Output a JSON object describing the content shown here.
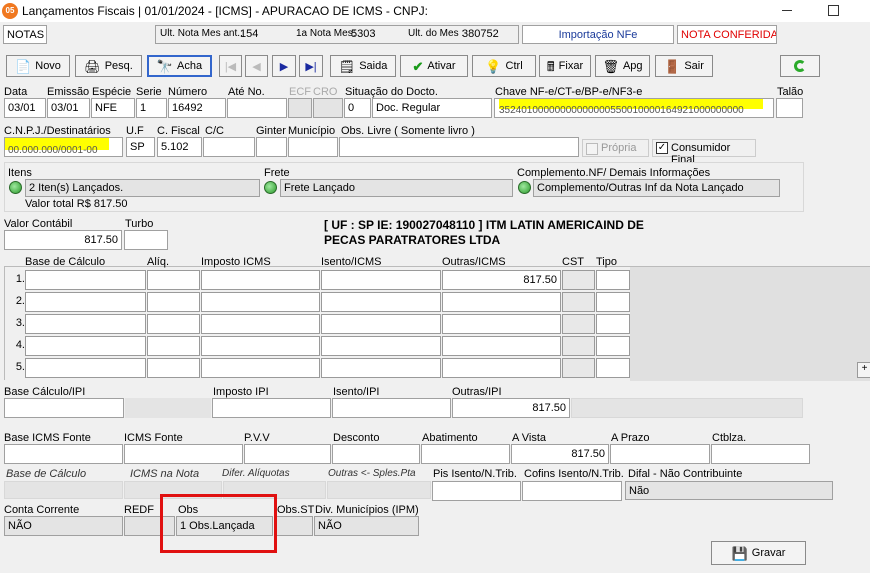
{
  "window": {
    "title": "Lançamentos Fiscais | 01/01/2024 - [ICMS] - APURACAO DE ICMS - CNPJ:",
    "app_badge": "05"
  },
  "infobar": {
    "notas": "NOTAS",
    "ult_nota_label": "Ult. Nota Mes ant.:",
    "ult_nota_value": "154",
    "primeira_nota_label": "1a Nota Mes:",
    "primeira_nota_value": "5303",
    "ult_mes_label": "Ult. do Mes :",
    "ult_mes_value": "380752",
    "importacao": "Importação NFe",
    "status": "NOTA CONFERIDA"
  },
  "toolbar": {
    "novo": "Novo",
    "pesq": "Pesq.",
    "acha": "Acha",
    "saida": "Saida",
    "ativar": "Ativar",
    "ctrl": "Ctrl",
    "fixar": "Fixar",
    "apg": "Apg",
    "sair": "Sair"
  },
  "header": {
    "labels": {
      "data": "Data",
      "emissao": "Emissão",
      "especie": "Espécie",
      "serie": "Serie",
      "numero": "Número",
      "ate_no": "Até No.",
      "ecf": "ECF",
      "cro": "CRO",
      "situacao": "Situação do Docto.",
      "chave": "Chave NF-e/CT-e/BP-e/NF3-e",
      "talao": "Talão"
    },
    "values": {
      "data": "03/01",
      "emissao": "03/01",
      "especie": "NFE",
      "serie": "1",
      "numero": "16492",
      "ate_no": "",
      "situacao_code": "0",
      "situacao_desc": "Doc. Regular",
      "chave": "35240100000000000000550010000164921000000000",
      "talao": ""
    }
  },
  "dest": {
    "labels": {
      "cnpj": "C.N.P.J./Destinatários",
      "uf": "U.F",
      "cfiscal": "C. Fiscal",
      "cc": "C/C",
      "ginter": "Ginter",
      "municipio": "Município",
      "obs_livre": "Obs. Livre ( Somente livro )"
    },
    "values": {
      "cnpj": "00.000.000/0001-00",
      "uf": "SP",
      "cfiscal": "5.102",
      "cc": "",
      "ginter": "",
      "municipio": "",
      "obs_livre": ""
    },
    "propria": "Própria",
    "propria_checked": false,
    "consumidor": "Consumidor Final",
    "consumidor_checked": true
  },
  "summary": {
    "itens_label": "Itens",
    "itens_value": "2 Iten(s) Lançados.",
    "valor_total": "Valor total R$ 817.50",
    "frete_label": "Frete",
    "frete_value": "Frete Lançado",
    "compl_label": "Complemento.NF/ Demais Informações",
    "compl_value": "Complemento/Outras Inf da Nota Lançado"
  },
  "valor": {
    "contabil_label": "Valor Contábil",
    "contabil_value": "817.50",
    "turbo_label": "Turbo",
    "turbo_value": "",
    "company_line1": "[ UF : SP IE: 190027048110 ] ITM LATIN AMERICAIND DE",
    "company_line2": "PECAS PARATRATORES LTDA"
  },
  "icms_table": {
    "headers": [
      "Base de Cálculo",
      "Alíq.",
      "Imposto ICMS",
      "Isento/ICMS",
      "Outras/ICMS",
      "CST",
      "Tipo"
    ],
    "rows": [
      {
        "n": "1.",
        "base": "",
        "aliq": "",
        "imposto": "",
        "isento": "",
        "outras": "817.50",
        "cst": "",
        "tipo": ""
      },
      {
        "n": "2.",
        "base": "",
        "aliq": "",
        "imposto": "",
        "isento": "",
        "outras": "",
        "cst": "",
        "tipo": ""
      },
      {
        "n": "3.",
        "base": "",
        "aliq": "",
        "imposto": "",
        "isento": "",
        "outras": "",
        "cst": "",
        "tipo": ""
      },
      {
        "n": "4.",
        "base": "",
        "aliq": "",
        "imposto": "",
        "isento": "",
        "outras": "",
        "cst": "",
        "tipo": ""
      },
      {
        "n": "5.",
        "base": "",
        "aliq": "",
        "imposto": "",
        "isento": "",
        "outras": "",
        "cst": "",
        "tipo": ""
      }
    ],
    "expand": "+"
  },
  "ipi": {
    "base_label": "Base Cálculo/IPI",
    "imposto_label": "Imposto IPI",
    "isento_label": "Isento/IPI",
    "outras_label": "Outras/IPI",
    "base": "",
    "imposto": "",
    "isento": "",
    "outras": "817.50"
  },
  "fonte": {
    "base_label": "Base ICMS Fonte",
    "icms_label": "ICMS Fonte",
    "pvv_label": "P.V.V",
    "desconto_label": "Desconto",
    "abatimento_label": "Abatimento",
    "vista_label": "A Vista",
    "prazo_label": "A Prazo",
    "ctblza_label": "Ctblza.",
    "vista": "817.50"
  },
  "difal": {
    "base_label": "Base de Cálculo",
    "icms_nota_label": "ICMS na Nota",
    "dif_aliq_label": "Difer. Alíquotas",
    "outras_label": "Outras <- Sples.Pta",
    "pis_label": "Pis Isento/N.Trib.",
    "cofins_label": "Cofins Isento/N.Trib.",
    "difal_label": "Difal - Não Contribuinte",
    "difal_value": "Não"
  },
  "footer": {
    "conta_label": "Conta Corrente",
    "conta_value": "NÃO",
    "redf_label": "REDF",
    "obs_label": "Obs",
    "obs_value": "1 Obs.Lançada",
    "obs_st_label": "Obs.ST",
    "div_label": "Div. Municípios (IPM)",
    "div_value": "NÃO",
    "gravar": "Gravar"
  },
  "colors": {
    "highlight": "#ffff00",
    "status_red": "#e00000",
    "annotation_red": "#e01010",
    "link_blue": "#1a3a9a"
  }
}
